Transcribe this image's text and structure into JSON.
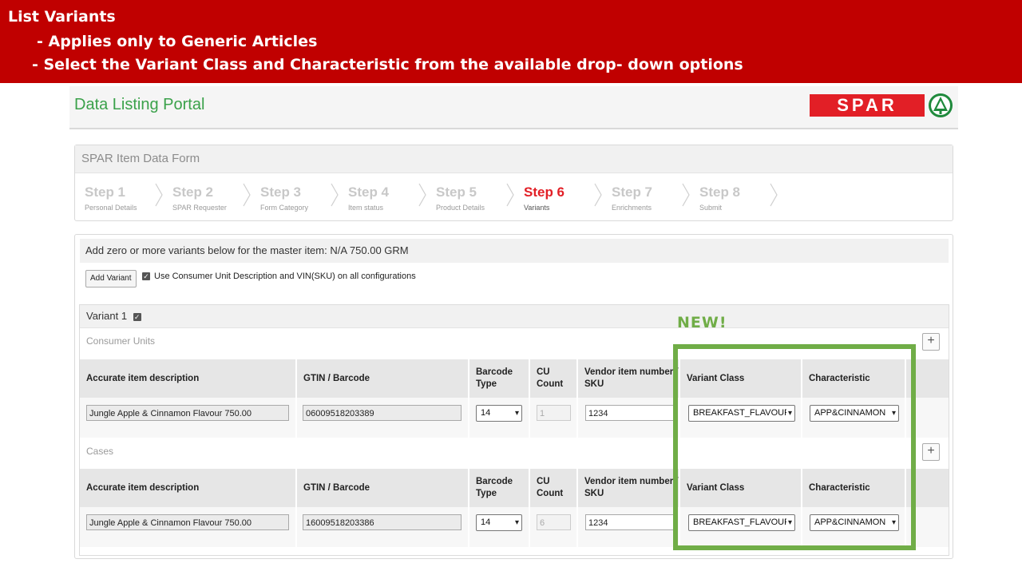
{
  "banner": {
    "title": "List Variants",
    "point1": "- Applies only to Generic Articles",
    "point2": "-  Select the Variant Class and Characteristic from the available drop- down options"
  },
  "portal": {
    "title": "Data Listing Portal",
    "logo_text": "SPAR",
    "brand_color": "#e21f26"
  },
  "form": {
    "header": "SPAR Item Data Form",
    "steps": [
      {
        "title": "Step 1",
        "sub": "Personal Details"
      },
      {
        "title": "Step 2",
        "sub": "SPAR Requester"
      },
      {
        "title": "Step 3",
        "sub": "Form Category"
      },
      {
        "title": "Step 4",
        "sub": "Item status"
      },
      {
        "title": "Step 5",
        "sub": "Product Details"
      },
      {
        "title": "Step 6",
        "sub": "Variants"
      },
      {
        "title": "Step 7",
        "sub": "Enrichments"
      },
      {
        "title": "Step 8",
        "sub": "Submit"
      }
    ],
    "active_step": "Step 6"
  },
  "variants": {
    "master_text": "Add zero or more variants below for the master item: N/A 750.00 GRM",
    "add_button": "Add Variant",
    "use_consumer_label": "Use Consumer Unit Description and VIN(SKU) on all configurations",
    "variant_label": "Variant 1",
    "columns": [
      "Accurate item description",
      "GTIN / Barcode",
      "Barcode Type",
      "CU Count",
      "Vendor item number / SKU",
      "Variant Class",
      "Characteristic"
    ],
    "consumer_units": {
      "label": "Consumer Units",
      "row": {
        "description": "Jungle Apple & Cinnamon Flavour 750.00",
        "gtin": "06009518203389",
        "barcode_type": "14",
        "cu_count": "1",
        "vendor_sku": "1234",
        "variant_class": "BREAKFAST_FLAVOUR",
        "characteristic": "APP&CINNAMON"
      }
    },
    "cases": {
      "label": "Cases",
      "row": {
        "description": "Jungle Apple & Cinnamon Flavour 750.00",
        "gtin": "16009518203386",
        "barcode_type": "14",
        "cu_count": "6",
        "vendor_sku": "1234",
        "variant_class": "BREAKFAST_FLAVOUR",
        "characteristic": "APP&CINNAMON"
      }
    }
  },
  "callout": {
    "new_label": "NEW!",
    "highlight_color": "#70ad47"
  }
}
